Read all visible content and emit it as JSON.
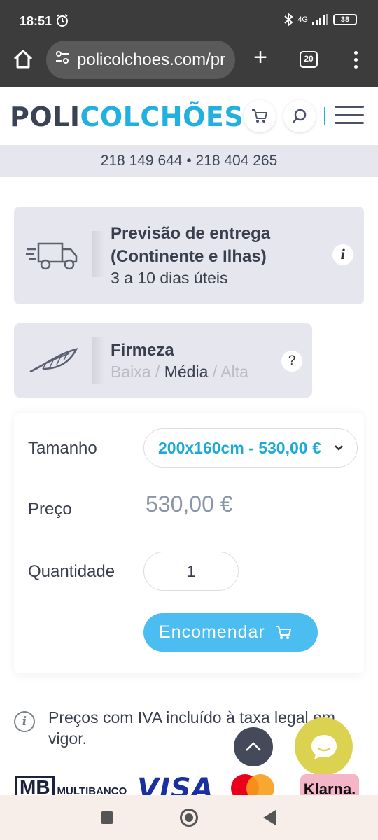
{
  "status_bar": {
    "time": "18:51",
    "network": "4G",
    "battery": "38"
  },
  "browser": {
    "url": "policolchoes.com/pr",
    "tab_count": "20"
  },
  "header": {
    "logo_part1": "POLI",
    "logo_part2": "COLCHÕES"
  },
  "phones": "218 149 644 • 218 404 265",
  "delivery": {
    "title_line1": "Previsão de entrega",
    "title_line2": "(Continente e Ilhas)",
    "subtitle": "3 a 10 dias úteis",
    "info_label": "i"
  },
  "firmness": {
    "title": "Firmeza",
    "options": [
      "Baixa",
      "Média",
      "Alta"
    ],
    "separator": " / ",
    "selected": "Média",
    "help_label": "?"
  },
  "form": {
    "size_label": "Tamanho",
    "size_value": "200x160cm - 530,00 €",
    "price_label": "Preço",
    "price_value": "530,00 €",
    "quantity_label": "Quantidade",
    "quantity_value": "1",
    "order_button": "Encomendar"
  },
  "vat_note": "Preços com IVA incluído à taxa legal em vigor.",
  "payment": {
    "multibanco_logo": "MB",
    "multibanco_text": "MULTIBANCO",
    "visa": "VISA",
    "klarna": "Klarna."
  },
  "colors": {
    "brand_dark": "#3a4256",
    "brand_blue": "#22b1de",
    "button_blue": "#4bbdf1",
    "chat_yellow": "#dbd34f"
  }
}
